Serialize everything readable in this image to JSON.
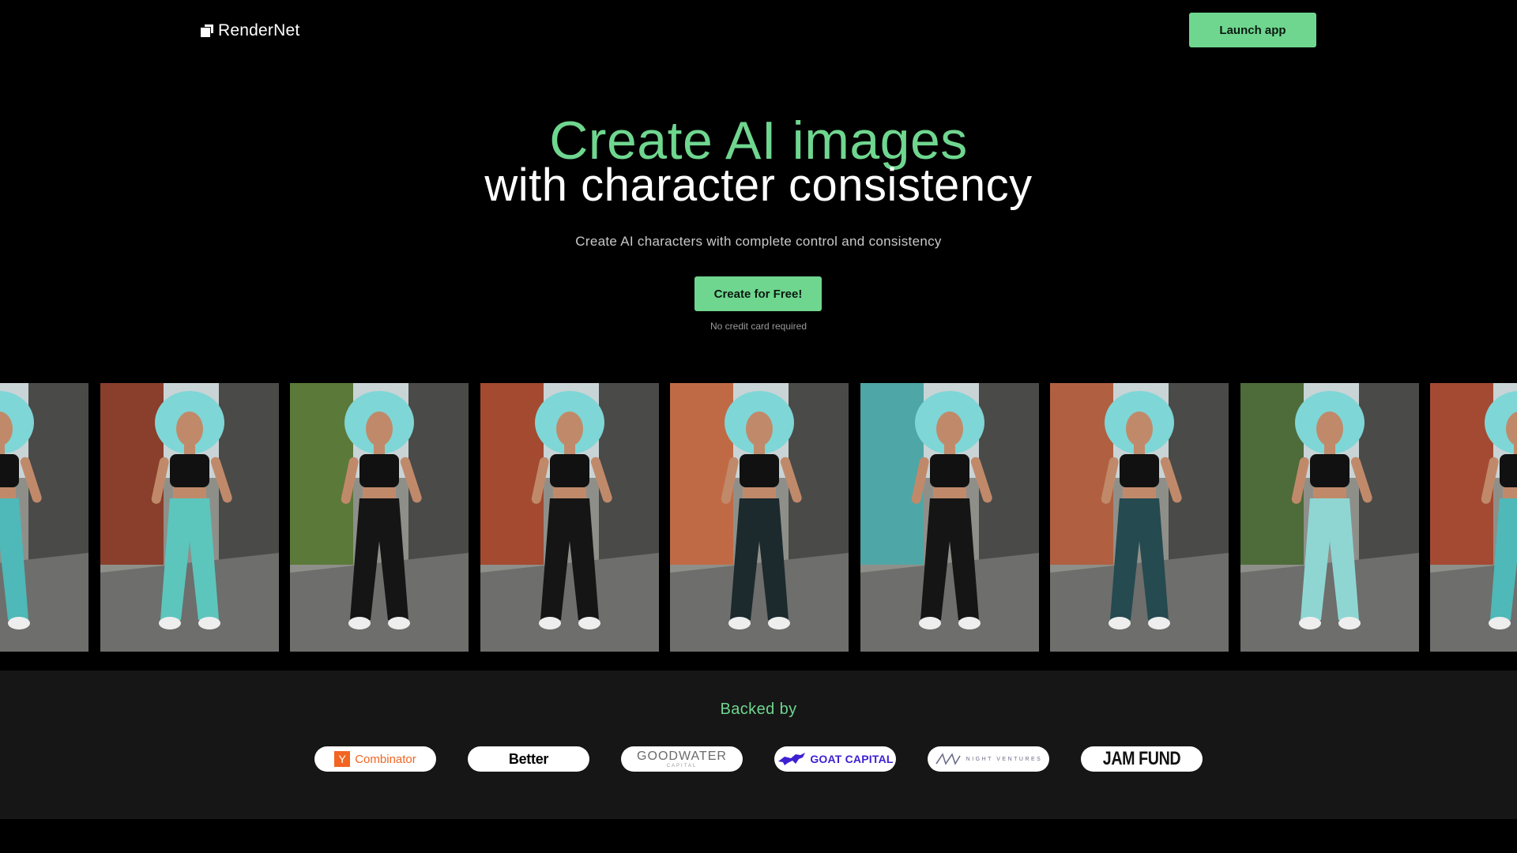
{
  "nav": {
    "logo_text": "RenderNet",
    "launch_label": "Launch app"
  },
  "hero": {
    "title_line1": "Create AI images",
    "title_line2": "with character consistency",
    "subtitle": "Create AI characters with complete control and consistency",
    "cta_label": "Create for Free!",
    "cta_note": "No credit card required"
  },
  "gallery": {
    "images": [
      {
        "pants": "#4fb8b8",
        "wall": "#b85a35",
        "hair": "#7fd6d6"
      },
      {
        "pants": "#5cc6bd",
        "wall": "#8a3f2c",
        "hair": "#7fd6d6"
      },
      {
        "pants": "#151515",
        "wall": "#5b7a3a",
        "hair": "#7fd6d6"
      },
      {
        "pants": "#151515",
        "wall": "#a34a30",
        "hair": "#7fd6d6"
      },
      {
        "pants": "#1c2a2e",
        "wall": "#c06a45",
        "hair": "#7fd6d6"
      },
      {
        "pants": "#151515",
        "wall": "#4fa6a6",
        "hair": "#7fd6d6"
      },
      {
        "pants": "#254a50",
        "wall": "#b06040",
        "hair": "#7fd6d6"
      },
      {
        "pants": "#8fd6d3",
        "wall": "#4e6b3a",
        "hair": "#7fd6d6"
      },
      {
        "pants": "#4fb8b8",
        "wall": "#a44a33",
        "hair": "#7fd6d6"
      }
    ]
  },
  "backed": {
    "title": "Backed by",
    "investors": {
      "yc_mark": "Y",
      "yc_text": "Combinator",
      "better": "Better",
      "goodwater": "GOODWATER",
      "goodwater_sub": "CAPITAL",
      "goat": "GOAT CAPITAL",
      "night": "NIGHT VENTURES",
      "jam": "JAM FUND"
    }
  },
  "colors": {
    "accent": "#6fd68f",
    "background": "#000000",
    "section_bg": "#161616"
  }
}
